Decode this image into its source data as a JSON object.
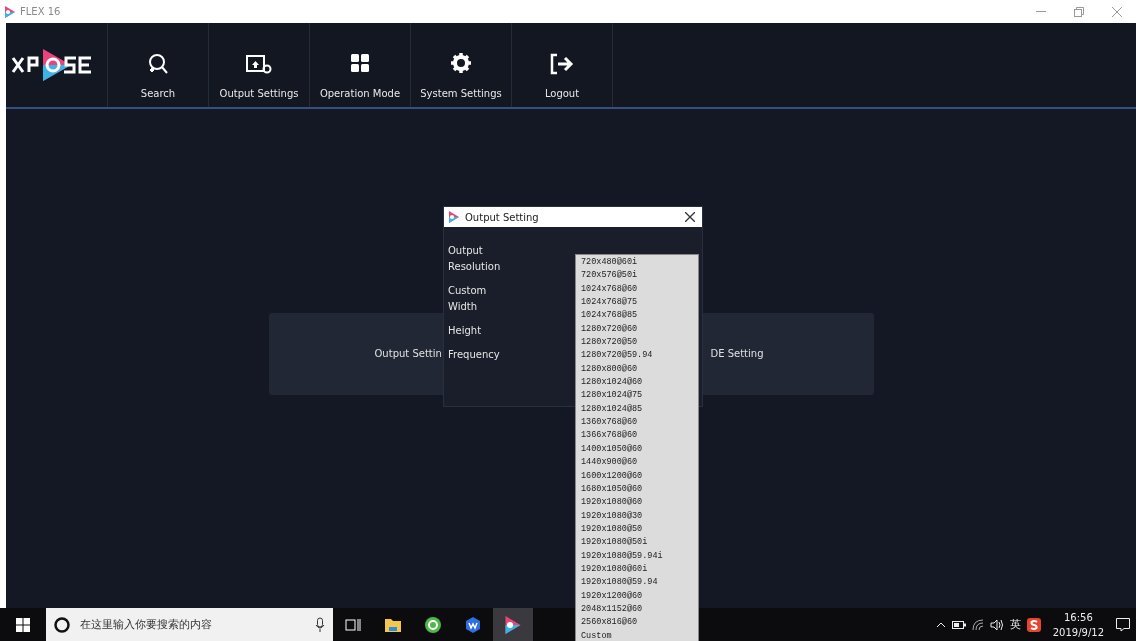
{
  "window": {
    "title": "FLEX 16"
  },
  "nav": [
    {
      "kind": "search",
      "label": "Search"
    },
    {
      "kind": "output",
      "label": "Output Settings"
    },
    {
      "kind": "mode",
      "label": "Operation Mode"
    },
    {
      "kind": "system",
      "label": "System Settings"
    },
    {
      "kind": "logout",
      "label": "Logout"
    }
  ],
  "panel": {
    "left_label": "Output Settin",
    "right_label": "DE Setting"
  },
  "dialog": {
    "title": "Output Setting",
    "fields": [
      "Output Resolution",
      "Custom Width",
      "Height",
      "Frequency"
    ],
    "options": [
      "720x480@60i",
      "720x576@50i",
      "1024x768@60",
      "1024x768@75",
      "1024x768@85",
      "1280x720@60",
      "1280x720@50",
      "1280x720@59.94",
      "1280x800@60",
      "1280x1024@60",
      "1280x1024@75",
      "1280x1024@85",
      "1360x768@60",
      "1366x768@60",
      "1400x1050@60",
      "1440x900@60",
      "1600x1200@60",
      "1680x1050@60",
      "1920x1080@60",
      "1920x1080@30",
      "1920x1080@50",
      "1920x1080@50i",
      "1920x1080@59.94i",
      "1920x1080@60i",
      "1920x1080@59.94",
      "1920x1200@60",
      "2048x1152@60",
      "2560x816@60",
      "Custom"
    ]
  },
  "taskbar": {
    "search": {
      "placeholder": "在这里输入你要搜索的内容"
    },
    "apps": [
      {
        "kind": "explorer",
        "selected": false
      },
      {
        "kind": "browser",
        "selected": false
      },
      {
        "kind": "office",
        "selected": false
      },
      {
        "kind": "xpose",
        "selected": true
      }
    ],
    "language": "英",
    "time": "16:56",
    "date": "2019/9/12"
  }
}
